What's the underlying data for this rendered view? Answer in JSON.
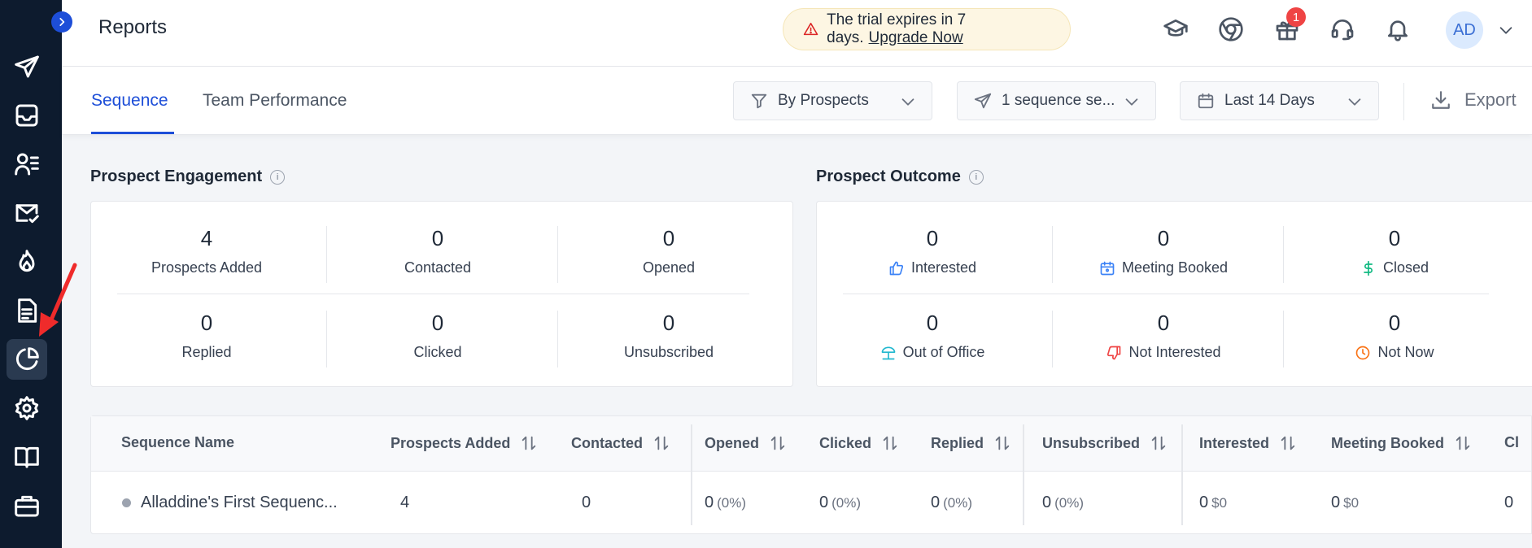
{
  "header": {
    "title": "Reports",
    "trial_text": "The trial expires in 7 days.",
    "trial_link": "Upgrade Now",
    "notification_count": "1",
    "avatar_initials": "AD"
  },
  "tabs": [
    {
      "label": "Sequence",
      "active": true
    },
    {
      "label": "Team Performance",
      "active": false
    }
  ],
  "filters": {
    "by": "By Prospects",
    "sequence": "1 sequence se...",
    "date": "Last 14 Days",
    "export": "Export"
  },
  "engagement": {
    "title": "Prospect Engagement",
    "stats": [
      {
        "value": "4",
        "label": "Prospects Added"
      },
      {
        "value": "0",
        "label": "Contacted"
      },
      {
        "value": "0",
        "label": "Opened"
      },
      {
        "value": "0",
        "label": "Replied"
      },
      {
        "value": "0",
        "label": "Clicked"
      },
      {
        "value": "0",
        "label": "Unsubscribed"
      }
    ]
  },
  "outcome": {
    "title": "Prospect Outcome",
    "stats": [
      {
        "value": "0",
        "label": "Interested",
        "icon": "thumbs-up-icon",
        "color": "#3b82f6"
      },
      {
        "value": "0",
        "label": "Meeting Booked",
        "icon": "calendar-icon",
        "color": "#3b82f6"
      },
      {
        "value": "0",
        "label": "Closed",
        "icon": "dollar-icon",
        "color": "#10b981"
      },
      {
        "value": "0",
        "label": "Out of Office",
        "icon": "beach-umbrella-icon",
        "color": "#22b8cf"
      },
      {
        "value": "0",
        "label": "Not Interested",
        "icon": "thumbs-down-icon",
        "color": "#ef4444"
      },
      {
        "value": "0",
        "label": "Not Now",
        "icon": "clock-icon",
        "color": "#f97316"
      }
    ]
  },
  "table": {
    "columns": [
      "Sequence Name",
      "Prospects Added",
      "Contacted",
      "Opened",
      "Clicked",
      "Replied",
      "Unsubscribed",
      "Interested",
      "Meeting Booked",
      "Cl"
    ],
    "row": {
      "name": "Alladdine's First Sequenc...",
      "prospects_added": "4",
      "contacted": "0",
      "opened": "0",
      "opened_pct": "(0%)",
      "clicked": "0",
      "clicked_pct": "(0%)",
      "replied": "0",
      "replied_pct": "(0%)",
      "unsubscribed": "0",
      "unsubscribed_pct": "(0%)",
      "interested": "0",
      "interested_amt": "$0",
      "meeting_booked": "0",
      "meeting_booked_amt": "$0",
      "closed": "0"
    }
  },
  "colors": {
    "sidebar_bg": "#0d1b2e",
    "accent": "#1d4ed8",
    "trial_bg": "#fdf6e3"
  }
}
